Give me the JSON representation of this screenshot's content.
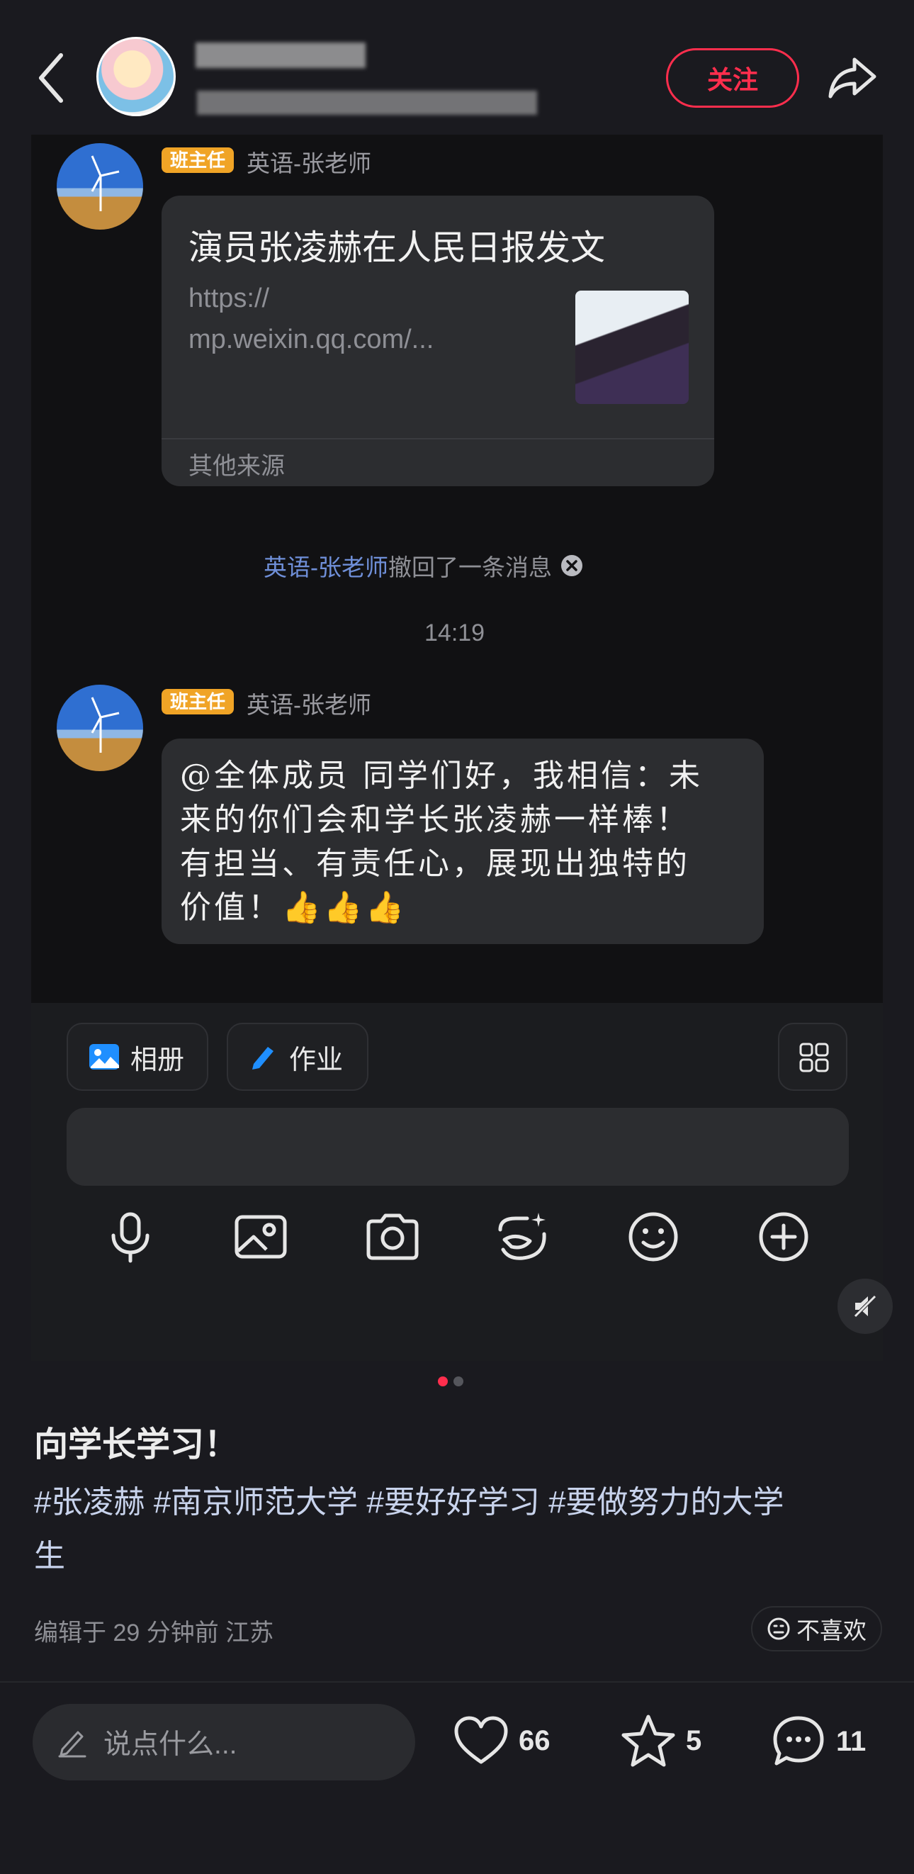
{
  "header": {
    "follow_label": "关注",
    "author_name_obscured": "",
    "author_status_obscured": ""
  },
  "chat": {
    "msg1": {
      "role_badge": "班主任",
      "sender": "英语-张老师",
      "card_title": "演员张凌赫在人民日报发文",
      "card_url_line1": "https://",
      "card_url_line2": "mp.weixin.qq.com/...",
      "card_source": "其他来源"
    },
    "recall": {
      "name": "英语-张老师",
      "text": "撤回了一条消息"
    },
    "time": "14:19",
    "msg2": {
      "role_badge": "班主任",
      "sender": "英语-张老师",
      "line1": "@全体成员 同学们好，我相信：未",
      "line2": "来的你们会和学长张凌赫一样棒！",
      "line3": "有担当、有责任心，展现出独特的",
      "line4": "价值！👍👍👍"
    },
    "toolbar": {
      "album_label": "相册",
      "homework_label": "作业"
    }
  },
  "post": {
    "title": "向学长学习！",
    "tags_line1": "#张凌赫 #南京师范大学 #要好好学习 #要做努力的大学",
    "tags_line2": "生",
    "meta": "编辑于 29 分钟前 江苏",
    "dislike_label": "不喜欢"
  },
  "bottom_bar": {
    "comment_placeholder": "说点什么...",
    "likes": "66",
    "stars": "5",
    "comments": "11"
  },
  "colors": {
    "accent": "#ff2e4d",
    "badge": "#f0a426",
    "background": "#1a1a1f"
  }
}
